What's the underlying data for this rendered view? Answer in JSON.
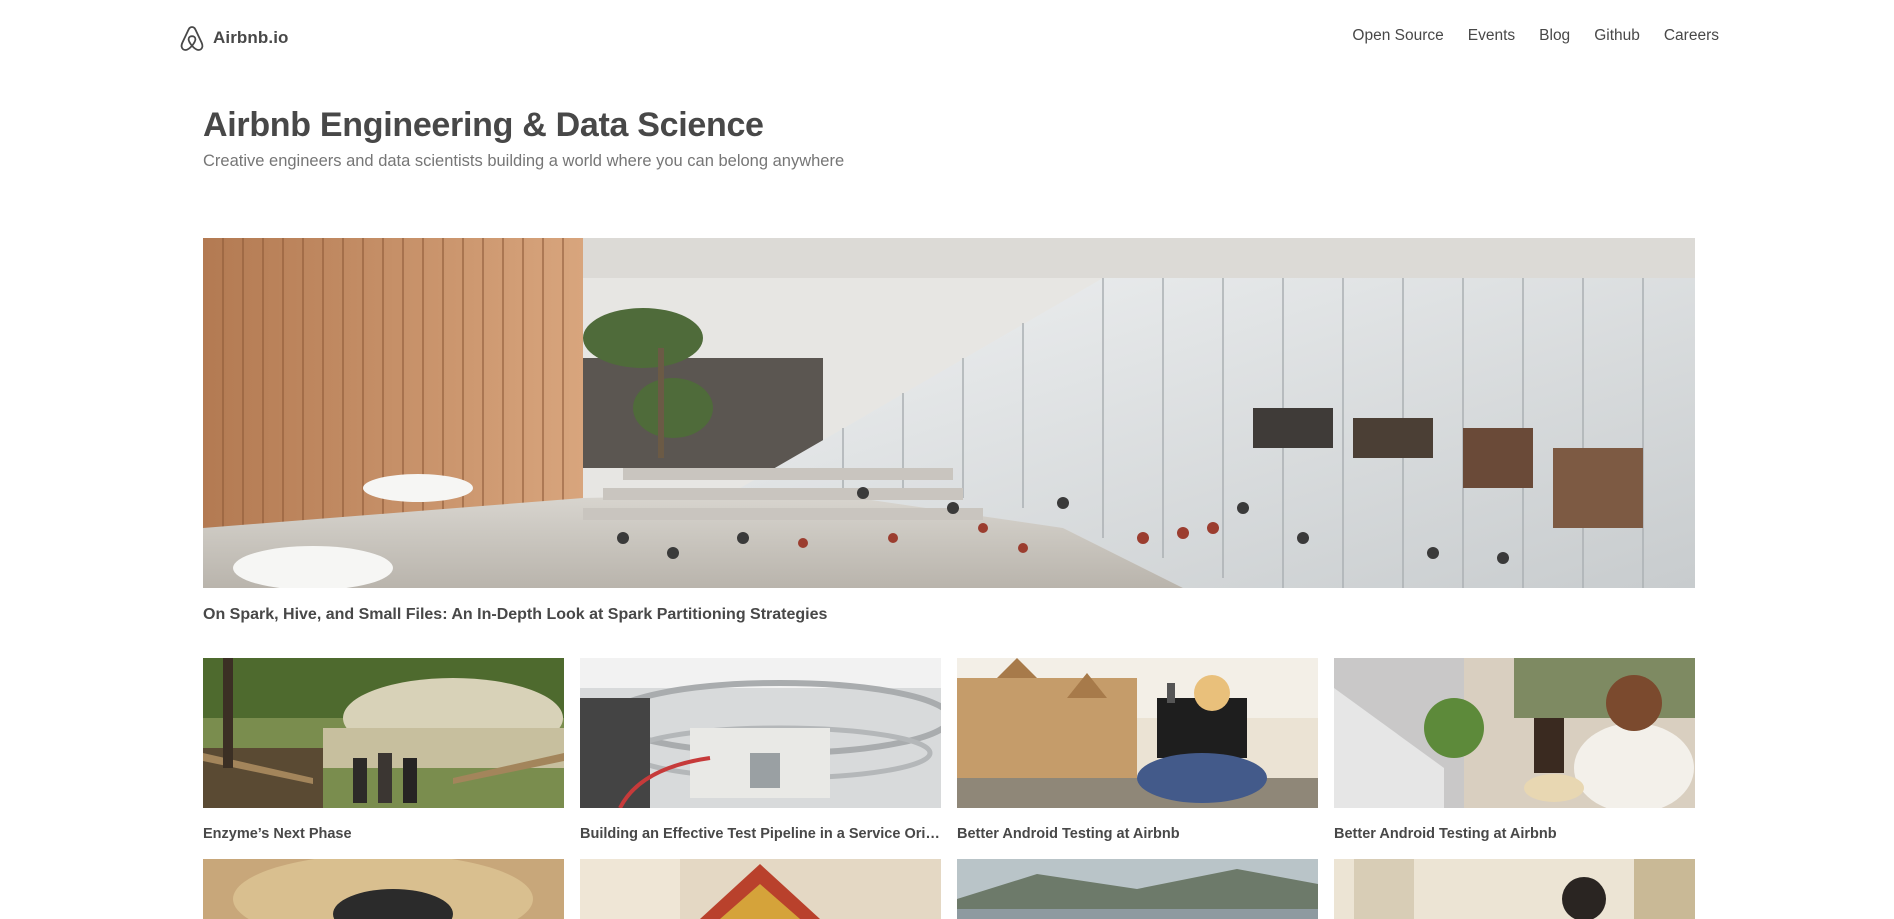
{
  "nav": {
    "brand": "Airbnb.io",
    "links": [
      "Open Source",
      "Events",
      "Blog",
      "Github",
      "Careers"
    ]
  },
  "header": {
    "title": "Airbnb Engineering & Data Science",
    "subtitle": "Creative engineers and data scientists building a world where you can belong anywhere"
  },
  "featured": {
    "title": "On Spark, Hive, and Small Files: An In-Depth Look at Spark Partitioning Strategies"
  },
  "cards": [
    {
      "title": "Enzyme’s Next Phase"
    },
    {
      "title": "Building an Effective Test Pipeline in a Service Oriented Architecture"
    },
    {
      "title": "Better Android Testing at Airbnb"
    },
    {
      "title": "Better Android Testing at Airbnb"
    }
  ],
  "colors": {
    "text": "#484848",
    "muted": "#767676"
  }
}
